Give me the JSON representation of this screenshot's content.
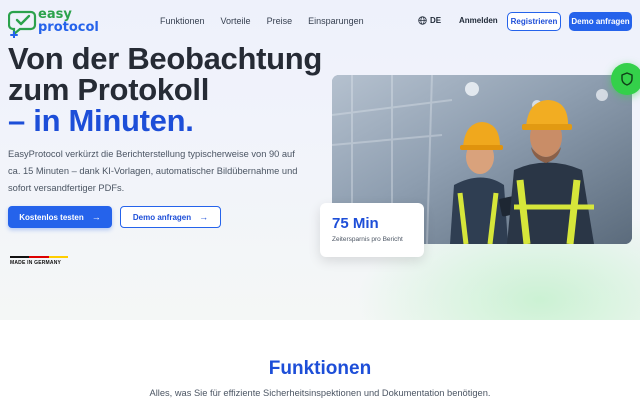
{
  "brand": {
    "line1": "easy",
    "line2": "protocol",
    "colors": {
      "green": "#2ba24c",
      "blue": "#2563eb"
    }
  },
  "nav": {
    "links": [
      "Funktionen",
      "Vorteile",
      "Preise",
      "Einsparungen"
    ],
    "language": "DE",
    "login": "Anmelden",
    "register": "Registrieren",
    "demo": "Demo anfragen"
  },
  "hero": {
    "title_line1": "Von der Beobachtung",
    "title_line2": "zum Protokoll",
    "title_line3": "– in Minuten.",
    "description": "EasyProtocol verkürzt die Berichterstellung typischerweise von 90 auf ca. 15 Minuten – dank KI-Vorlagen, automatischer Bildübernahme und sofort versandfertiger PDFs.",
    "cta_primary": "Kostenlos testen",
    "cta_secondary": "Demo anfragen",
    "made_in": "MADE IN GERMANY",
    "icons": {
      "arrow": "arrow-right-icon",
      "shield": "shield-icon",
      "globe": "globe-icon"
    }
  },
  "stat": {
    "value": "75 Min",
    "label": "Zeitersparnis pro Bericht"
  },
  "features": {
    "title": "Funktionen",
    "subtitle": "Alles, was Sie für effiziente Sicherheitsinspektionen und Dokumentation benötigen."
  }
}
